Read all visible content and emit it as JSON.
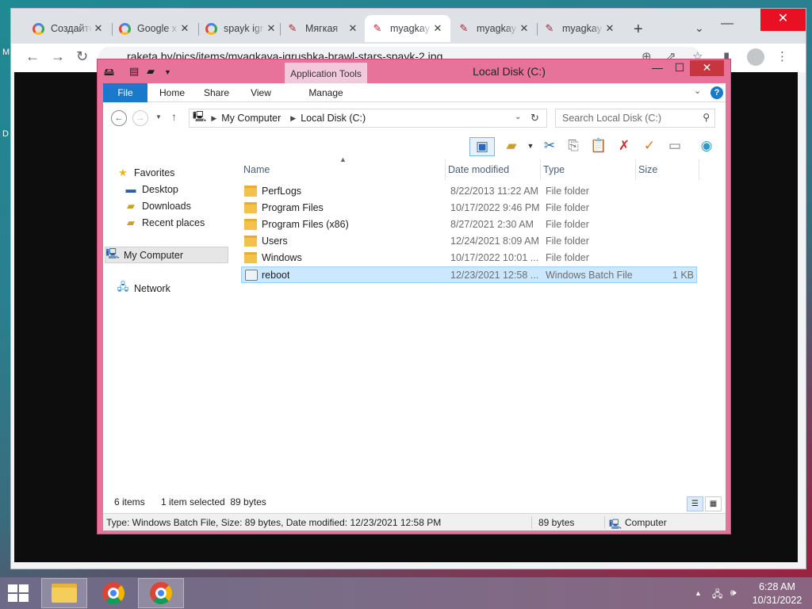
{
  "desktop": {
    "edge_letters": [
      "M",
      "D"
    ]
  },
  "chrome": {
    "tabs": [
      {
        "title": "Создайте",
        "favicon": "google-icon"
      },
      {
        "title": "Google x",
        "favicon": "google-icon"
      },
      {
        "title": "spayk igr",
        "favicon": "google-icon"
      },
      {
        "title": "Мягкая",
        "favicon": "toy-icon"
      },
      {
        "title": "myagkay",
        "favicon": "toy-icon",
        "active": true
      },
      {
        "title": "myagkay",
        "favicon": "toy-icon"
      },
      {
        "title": "myagkay",
        "favicon": "toy-icon"
      }
    ],
    "url": "raketa.by/pics/items/myagkaya-igrushka-brawl-stars-spayk-2.jpg"
  },
  "explorer": {
    "title": "Local Disk (C:)",
    "contextual_tab": "Application Tools",
    "ribbon_tabs": [
      "File",
      "Home",
      "Share",
      "View",
      "Manage"
    ],
    "breadcrumb": [
      "My Computer",
      "Local Disk (C:)"
    ],
    "search_placeholder": "Search Local Disk (C:)",
    "nav": {
      "favorites_label": "Favorites",
      "favorites": [
        "Desktop",
        "Downloads",
        "Recent places"
      ],
      "computer": "My Computer",
      "network": "Network"
    },
    "columns": [
      "Name",
      "Date modified",
      "Type",
      "Size"
    ],
    "files": [
      {
        "name": "PerfLogs",
        "date": "8/22/2013 11:22 AM",
        "type": "File folder",
        "size": "",
        "kind": "folder"
      },
      {
        "name": "Program Files",
        "date": "10/17/2022 9:46 PM",
        "type": "File folder",
        "size": "",
        "kind": "folder"
      },
      {
        "name": "Program Files (x86)",
        "date": "8/27/2021 2:30 AM",
        "type": "File folder",
        "size": "",
        "kind": "folder"
      },
      {
        "name": "Users",
        "date": "12/24/2021 8:09 AM",
        "type": "File folder",
        "size": "",
        "kind": "folder"
      },
      {
        "name": "Windows",
        "date": "10/17/2022 10:01 ...",
        "type": "File folder",
        "size": "",
        "kind": "folder"
      },
      {
        "name": "reboot",
        "date": "12/23/2021 12:58 ...",
        "type": "Windows Batch File",
        "size": "1 KB",
        "kind": "batch",
        "selected": true
      }
    ],
    "items_count": "6 items",
    "selection_info": "1 item selected  89 bytes",
    "status": {
      "details": "Type: Windows Batch File, Size: 89 bytes, Date modified: 12/23/2021 12:58 PM",
      "size": "89 bytes",
      "location": "Computer"
    }
  },
  "taskbar": {
    "time": "6:28 AM",
    "date": "10/31/2022"
  },
  "colors": {
    "explorer_frame": "#e8739a",
    "file_tab": "#1979ca",
    "selection": "#cce8ff",
    "close_button": "#c7363e"
  }
}
